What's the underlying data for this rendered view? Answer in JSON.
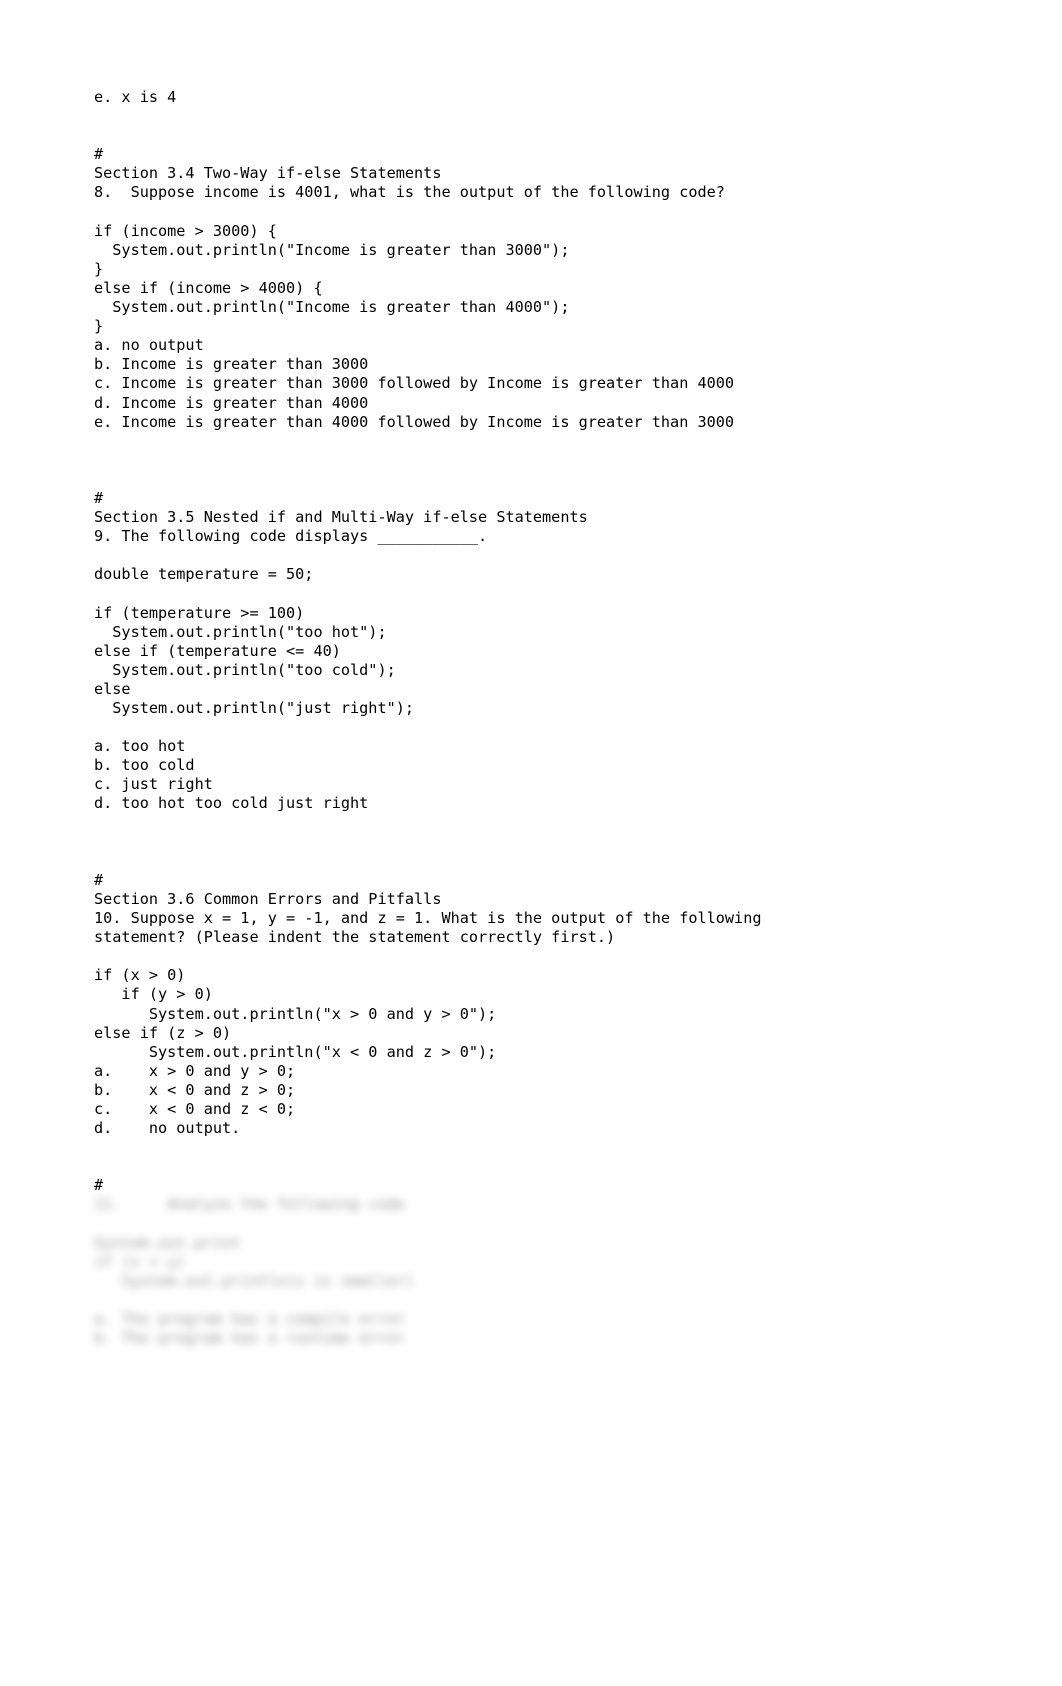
{
  "document": {
    "page_background": "#ffffff",
    "text_color": "#000000",
    "lines": [
      "e. x is 4",
      "",
      "",
      "#",
      "Section 3.4 Two-Way if-else Statements",
      "8.  Suppose income is 4001, what is the output of the following code?",
      "",
      "if (income > 3000) {",
      "  System.out.println(\"Income is greater than 3000\");",
      "}",
      "else if (income > 4000) {",
      "  System.out.println(\"Income is greater than 4000\");",
      "}",
      "a. no output",
      "b. Income is greater than 3000",
      "c. Income is greater than 3000 followed by Income is greater than 4000",
      "d. Income is greater than 4000",
      "e. Income is greater than 4000 followed by Income is greater than 3000",
      "",
      "",
      "",
      "#",
      "Section 3.5 Nested if and Multi-Way if-else Statements",
      "9. The following code displays ___________.",
      "",
      "double temperature = 50;",
      "",
      "if (temperature >= 100)",
      "  System.out.println(\"too hot\");",
      "else if (temperature <= 40)",
      "  System.out.println(\"too cold\");",
      "else",
      "  System.out.println(\"just right\");",
      "",
      "a. too hot",
      "b. too cold",
      "c. just right",
      "d. too hot too cold just right",
      "",
      "",
      "",
      "#",
      "Section 3.6 Common Errors and Pitfalls",
      "10. Suppose x = 1, y = -1, and z = 1. What is the output of the following",
      "statement? (Please indent the statement correctly first.)",
      "",
      "if (x > 0)",
      "   if (y > 0)",
      "      System.out.println(\"x > 0 and y > 0\");",
      "else if (z > 0)",
      "      System.out.println(\"x < 0 and z > 0\");",
      "a.    x > 0 and y > 0;",
      "b.    x < 0 and z > 0;",
      "c.    x < 0 and z < 0;",
      "d.    no output.",
      "",
      "",
      "#"
    ],
    "redacted": {
      "description": "blurred-illegible-text",
      "lines": [
        "11.     Analyze the following code",
        "",
        "System.out.print",
        "if (x < y)",
        "   System.out.println(x is smaller)",
        "",
        "a. The program has a compile error",
        "b. The program has a runtime error"
      ]
    }
  }
}
